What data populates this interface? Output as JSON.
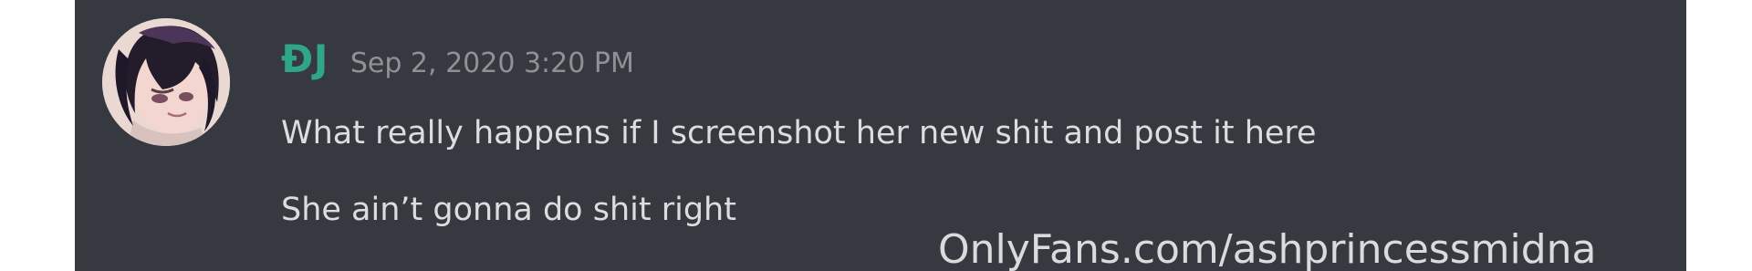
{
  "message": {
    "username": "ĐJ",
    "timestamp": "Sep 2, 2020 3:20 PM",
    "lines": [
      "What really happens if I screenshot her new shit and post it here",
      "She ain’t gonna do shit right"
    ],
    "avatar_icon": "anime-avatar-icon"
  },
  "watermark": {
    "text": "OnlyFans.com/ashprincessmidna"
  },
  "colors": {
    "background": "#36393f",
    "username": "#2fa68a",
    "timestamp": "#8e9297",
    "message_text": "#dcddde"
  }
}
